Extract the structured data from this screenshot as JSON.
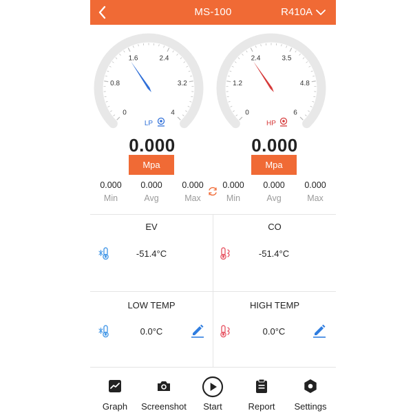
{
  "header": {
    "title": "MS-100",
    "refrigerant": "R410A"
  },
  "colors": {
    "accent": "#f06a35",
    "low_pressure": "#2f6fd8",
    "high_pressure": "#d63a3a",
    "track": "#e8e8e8"
  },
  "gauges": {
    "low": {
      "label": "LP",
      "ticks": [
        "0",
        "0.8",
        "1.6",
        "2.4",
        "3.2",
        "4"
      ],
      "max": 4,
      "needle_value": 1.5,
      "reading": "0.000",
      "unit": "Mpa",
      "stats": [
        {
          "value": "0.000",
          "label": "Min"
        },
        {
          "value": "0.000",
          "label": "Avg"
        },
        {
          "value": "0.000",
          "label": "Max"
        }
      ]
    },
    "high": {
      "label": "HP",
      "ticks": [
        "0",
        "1.2",
        "2.4",
        "3.5",
        "4.8",
        "6"
      ],
      "max": 6,
      "needle_value": 2.25,
      "reading": "0.000",
      "unit": "Mpa",
      "stats": [
        {
          "value": "0.000",
          "label": "Min"
        },
        {
          "value": "0.000",
          "label": "Avg"
        },
        {
          "value": "0.000",
          "label": "Max"
        }
      ]
    }
  },
  "cells": {
    "ev": {
      "title": "EV",
      "value": "-51.4°C"
    },
    "co": {
      "title": "CO",
      "value": "-51.4°C"
    },
    "low_temp": {
      "title": "LOW TEMP",
      "value": "0.0°C"
    },
    "high_temp": {
      "title": "HIGH TEMP",
      "value": "0.0°C"
    }
  },
  "nav": {
    "graph": "Graph",
    "screenshot": "Screenshot",
    "start": "Start",
    "report": "Report",
    "settings": "Settings"
  }
}
